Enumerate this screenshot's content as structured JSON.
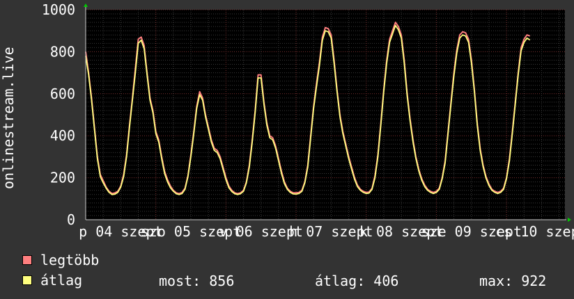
{
  "colors": {
    "background": "#333333",
    "plot_background": "#000000",
    "grid_minor": "#3a3a3a",
    "grid_major": "#7a3030",
    "max_series": "#ff7f7f",
    "avg_series": "#ffff7f",
    "axis_arrow": "#00cc00"
  },
  "chart_data": {
    "type": "area",
    "ylabel": "onlinestream.live",
    "ylim": [
      0,
      1000
    ],
    "yticks": [
      0,
      200,
      400,
      600,
      800,
      1000
    ],
    "xticks": [
      "p 04 szept",
      "szo 05 szept",
      "v 06 szept",
      "h 07 szept",
      "k 08 szept",
      "sze 09 szept",
      "cs 10 szept"
    ],
    "x_start_hour": 0,
    "x_end_hour": 164,
    "tick_hours": [
      12,
      36,
      60,
      84,
      108,
      132,
      156
    ],
    "series": [
      {
        "name": "legtöbb",
        "color": "#ff7f7f",
        "x_hours": [
          0,
          1,
          2,
          3,
          4,
          5,
          6,
          7,
          8,
          9,
          10,
          11,
          12,
          13,
          14,
          15,
          16,
          17,
          18,
          19,
          20,
          21,
          22,
          23,
          24,
          25,
          26,
          27,
          28,
          29,
          30,
          31,
          32,
          33,
          34,
          35,
          36,
          37,
          38,
          39,
          40,
          41,
          42,
          43,
          44,
          45,
          46,
          47,
          48,
          49,
          50,
          51,
          52,
          53,
          54,
          55,
          56,
          57,
          58,
          59,
          60,
          61,
          62,
          63,
          64,
          65,
          66,
          67,
          68,
          69,
          70,
          71,
          72,
          73,
          74,
          75,
          76,
          77,
          78,
          79,
          80,
          81,
          82,
          83,
          84,
          85,
          86,
          87,
          88,
          89,
          90,
          91,
          92,
          93,
          94,
          95,
          96,
          97,
          98,
          99,
          100,
          101,
          102,
          103,
          104,
          105,
          106,
          107,
          108,
          109,
          110,
          111,
          112,
          113,
          114,
          115,
          116,
          117,
          118,
          119,
          120,
          121,
          122,
          123,
          124,
          125,
          126,
          127,
          128,
          129,
          130,
          131,
          132,
          133,
          134,
          135,
          136,
          137,
          138,
          139,
          140,
          141,
          142,
          143,
          144,
          145,
          146,
          147,
          148,
          149,
          150,
          151,
          152,
          153,
          154,
          155,
          156,
          157,
          158,
          159,
          160,
          161,
          162,
          163,
          164
        ],
        "values": [
          800,
          700,
          580,
          440,
          300,
          215,
          185,
          155,
          135,
          125,
          128,
          135,
          160,
          215,
          310,
          450,
          580,
          720,
          860,
          870,
          830,
          700,
          580,
          520,
          420,
          380,
          300,
          230,
          190,
          160,
          140,
          128,
          125,
          130,
          150,
          210,
          310,
          420,
          540,
          610,
          580,
          500,
          440,
          380,
          340,
          330,
          300,
          250,
          200,
          160,
          140,
          128,
          125,
          128,
          140,
          180,
          260,
          380,
          520,
          690,
          690,
          560,
          460,
          400,
          390,
          350,
          290,
          230,
          180,
          150,
          135,
          128,
          128,
          130,
          140,
          180,
          260,
          400,
          540,
          650,
          750,
          870,
          915,
          910,
          880,
          760,
          620,
          500,
          420,
          360,
          300,
          250,
          200,
          165,
          145,
          135,
          130,
          132,
          150,
          210,
          310,
          460,
          620,
          760,
          860,
          900,
          940,
          920,
          880,
          760,
          600,
          480,
          380,
          300,
          240,
          195,
          165,
          145,
          135,
          130,
          135,
          150,
          200,
          280,
          420,
          560,
          700,
          810,
          880,
          895,
          890,
          860,
          760,
          620,
          460,
          340,
          260,
          205,
          170,
          145,
          135,
          130,
          135,
          150,
          200,
          290,
          420,
          560,
          700,
          820,
          860,
          880,
          875
        ]
      },
      {
        "name": "átlag",
        "color": "#ffff7f",
        "x_hours": [
          0,
          1,
          2,
          3,
          4,
          5,
          6,
          7,
          8,
          9,
          10,
          11,
          12,
          13,
          14,
          15,
          16,
          17,
          18,
          19,
          20,
          21,
          22,
          23,
          24,
          25,
          26,
          27,
          28,
          29,
          30,
          31,
          32,
          33,
          34,
          35,
          36,
          37,
          38,
          39,
          40,
          41,
          42,
          43,
          44,
          45,
          46,
          47,
          48,
          49,
          50,
          51,
          52,
          53,
          54,
          55,
          56,
          57,
          58,
          59,
          60,
          61,
          62,
          63,
          64,
          65,
          66,
          67,
          68,
          69,
          70,
          71,
          72,
          73,
          74,
          75,
          76,
          77,
          78,
          79,
          80,
          81,
          82,
          83,
          84,
          85,
          86,
          87,
          88,
          89,
          90,
          91,
          92,
          93,
          94,
          95,
          96,
          97,
          98,
          99,
          100,
          101,
          102,
          103,
          104,
          105,
          106,
          107,
          108,
          109,
          110,
          111,
          112,
          113,
          114,
          115,
          116,
          117,
          118,
          119,
          120,
          121,
          122,
          123,
          124,
          125,
          126,
          127,
          128,
          129,
          130,
          131,
          132,
          133,
          134,
          135,
          136,
          137,
          138,
          139,
          140,
          141,
          142,
          143,
          144,
          145,
          146,
          147,
          148,
          149,
          150,
          151,
          152,
          153,
          154,
          155,
          156,
          157,
          158,
          159,
          160,
          161,
          162,
          163,
          164
        ],
        "values": [
          780,
          690,
          570,
          430,
          290,
          205,
          175,
          150,
          130,
          120,
          122,
          130,
          155,
          205,
          300,
          440,
          570,
          700,
          840,
          855,
          815,
          690,
          570,
          510,
          410,
          370,
          290,
          220,
          180,
          152,
          135,
          124,
          120,
          125,
          145,
          205,
          300,
          410,
          530,
          595,
          570,
          490,
          430,
          370,
          330,
          320,
          290,
          240,
          190,
          152,
          134,
          124,
          120,
          124,
          135,
          175,
          250,
          370,
          510,
          675,
          675,
          550,
          450,
          390,
          380,
          340,
          280,
          220,
          172,
          145,
          130,
          123,
          122,
          125,
          135,
          175,
          250,
          390,
          530,
          635,
          735,
          855,
          900,
          895,
          865,
          745,
          610,
          490,
          410,
          350,
          290,
          240,
          192,
          158,
          140,
          130,
          125,
          127,
          145,
          200,
          300,
          450,
          610,
          745,
          845,
          885,
          925,
          905,
          865,
          745,
          590,
          470,
          370,
          292,
          232,
          188,
          158,
          140,
          130,
          125,
          130,
          145,
          195,
          270,
          410,
          550,
          685,
          795,
          865,
          880,
          875,
          845,
          745,
          610,
          450,
          330,
          252,
          198,
          163,
          140,
          130,
          125,
          130,
          145,
          195,
          280,
          410,
          550,
          690,
          805,
          845,
          865,
          856
        ]
      }
    ]
  },
  "legend": {
    "items": [
      {
        "label": "legtöbb",
        "color": "#ff7f7f"
      },
      {
        "label": "átlag",
        "color": "#ffff7f"
      }
    ]
  },
  "stats": {
    "now": "most: 856",
    "avg": "átlag: 406",
    "max": "max: 922"
  }
}
